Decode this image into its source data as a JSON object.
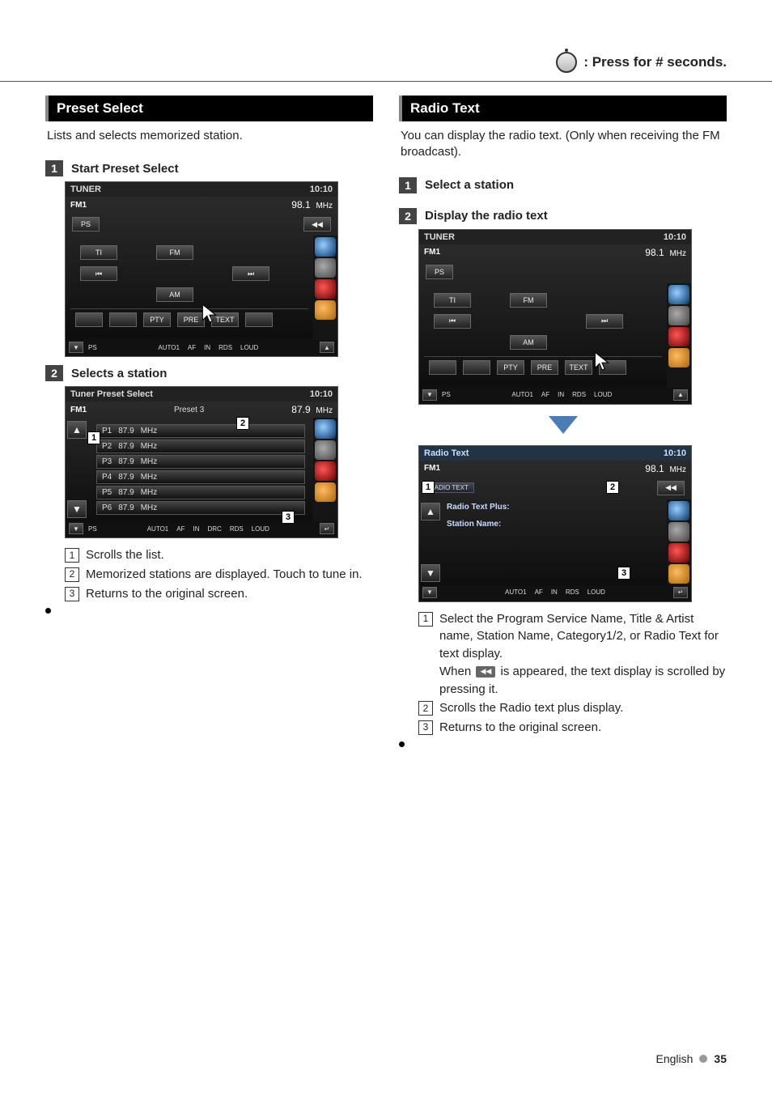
{
  "banner": {
    "text": ": Press for # seconds."
  },
  "left": {
    "heading": "Preset Select",
    "intro": "Lists and selects memorized station.",
    "step1": {
      "num": "1",
      "title": "Start Preset Select",
      "screen": {
        "title": "TUNER",
        "clock": "10:10",
        "band": "FM1",
        "freq": "98.1",
        "unit": "MHz",
        "ps_label": "PS",
        "btn_ti": "TI",
        "btn_fm": "FM",
        "btn_prev": "⏮",
        "btn_next": "⏭",
        "btn_am": "AM",
        "btn_pty": "PTY",
        "btn_pre": "PRE",
        "btn_text": "TEXT",
        "footer_ps": "PS",
        "footer_auto": "AUTO1",
        "footer_af": "AF",
        "footer_in": "IN",
        "footer_rds": "RDS",
        "footer_loud": "LOUD"
      }
    },
    "step2": {
      "num": "2",
      "title": "Selects a station",
      "screen": {
        "title": "Tuner Preset Select",
        "clock": "10:10",
        "band": "FM1",
        "preset_label": "Preset 3",
        "freq": "87.9",
        "unit": "MHz",
        "presets": [
          {
            "slot": "P1",
            "freq": "87.9",
            "unit": "MHz"
          },
          {
            "slot": "P2",
            "freq": "87.9",
            "unit": "MHz"
          },
          {
            "slot": "P3",
            "freq": "87.9",
            "unit": "MHz"
          },
          {
            "slot": "P4",
            "freq": "87.9",
            "unit": "MHz"
          },
          {
            "slot": "P5",
            "freq": "87.9",
            "unit": "MHz"
          },
          {
            "slot": "P6",
            "freq": "87.9",
            "unit": "MHz"
          }
        ],
        "footer_ps": "PS",
        "footer_auto": "AUTO1",
        "footer_af": "AF",
        "footer_in": "IN",
        "footer_drc": "DRC",
        "footer_rds": "RDS",
        "footer_loud": "LOUD",
        "callout1": "1",
        "callout2": "2",
        "callout3": "3"
      },
      "notes": {
        "n1": "Scrolls the list.",
        "n2": "Memorized stations are displayed. Touch to tune in.",
        "n3": "Returns to the original screen."
      }
    }
  },
  "right": {
    "heading": "Radio Text",
    "intro": "You can display the radio text. (Only when receiving the FM broadcast).",
    "step1": {
      "num": "1",
      "title": "Select a station"
    },
    "step2": {
      "num": "2",
      "title": "Display the radio text",
      "screen": {
        "title": "TUNER",
        "clock": "10:10",
        "band": "FM1",
        "freq": "98.1",
        "unit": "MHz",
        "ps_label": "PS",
        "btn_ti": "TI",
        "btn_fm": "FM",
        "btn_prev": "⏮",
        "btn_next": "⏭",
        "btn_am": "AM",
        "btn_pty": "PTY",
        "btn_pre": "PRE",
        "btn_text": "TEXT",
        "footer_ps": "PS",
        "footer_auto": "AUTO1",
        "footer_af": "AF",
        "footer_in": "IN",
        "footer_rds": "RDS",
        "footer_loud": "LOUD"
      }
    },
    "radiotext_screen": {
      "title": "Radio Text",
      "clock": "10:10",
      "band": "FM1",
      "freq": "98.1",
      "unit": "MHz",
      "chip": "RADIO TEXT",
      "line1": "Radio Text Plus:",
      "line2": "Station Name:",
      "footer_auto": "AUTO1",
      "footer_af": "AF",
      "footer_in": "IN",
      "footer_rds": "RDS",
      "footer_loud": "LOUD",
      "callout1": "1",
      "callout2": "2",
      "callout3": "3"
    },
    "notes": {
      "n1a": "Select the Program Service Name, Title & Artist name, Station Name, Category1/2, or Radio Text for text display.",
      "n1b_pre": "When ",
      "n1b_post": " is appeared, the text display is scrolled by pressing it.",
      "n2": "Scrolls the Radio text plus display.",
      "n3": "Returns to the original screen."
    }
  },
  "footer": {
    "lang": "English",
    "page": "35"
  }
}
